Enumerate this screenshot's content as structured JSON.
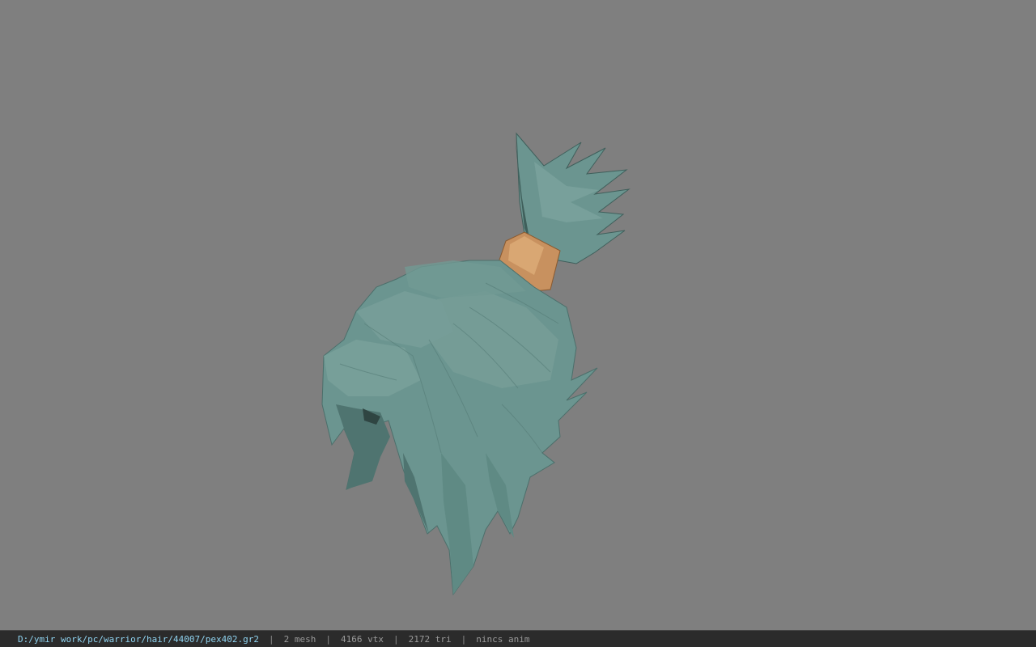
{
  "colors": {
    "background": "#7f7f7f",
    "hair": "#6b9590",
    "hair_dark": "#3f5f5b",
    "hair_light": "#86aca6",
    "hair_tie": "#c8915f",
    "status_bar_bg": "#2b2b2b",
    "path_text": "#8fd3f0"
  },
  "viewport": {
    "model_icon": "hair-model"
  },
  "status_bar": {
    "file_path": "D:/ymir work/pc/warrior/hair/44007/pex402.gr2",
    "separator": "|",
    "mesh_count": "2 mesh",
    "vertex_count": "4166 vtx",
    "triangle_count": "2172 tri",
    "animation": "nincs anim"
  }
}
